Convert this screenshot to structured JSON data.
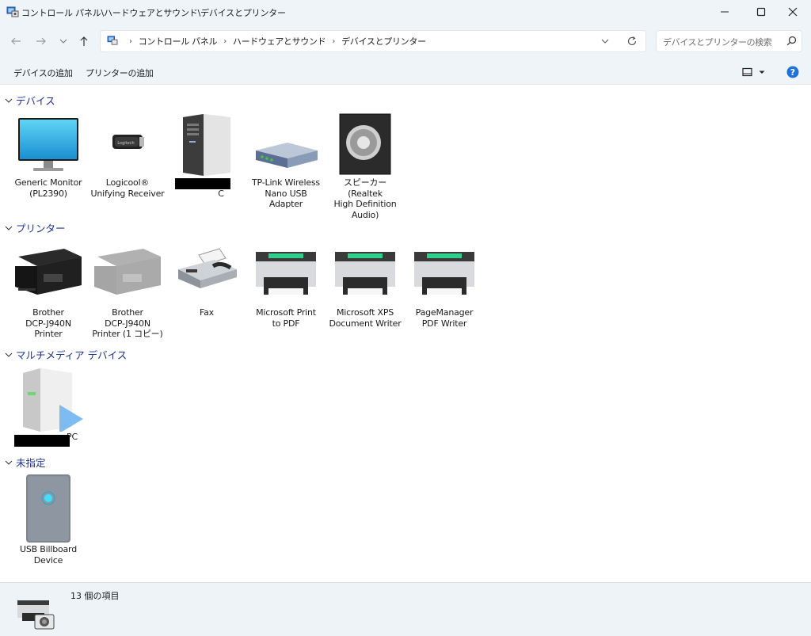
{
  "window": {
    "title": "コントロール パネル\\ハードウェアとサウンド\\デバイスとプリンター",
    "min_icon": "minimize-icon",
    "max_icon": "maximize-icon",
    "close_icon": "close-icon"
  },
  "nav": {
    "breadcrumbs": [
      "コントロール パネル",
      "ハードウェアとサウンド",
      "デバイスとプリンター"
    ],
    "search_placeholder": "デバイスとプリンターの検索"
  },
  "commands": {
    "add_device": "デバイスの追加",
    "add_printer": "プリンターの追加"
  },
  "groups": {
    "devices": {
      "header": "デバイス",
      "items": [
        {
          "label": "Generic Monitor\n(PL2390)",
          "icon": "monitor-icon"
        },
        {
          "label": "Logicool®\nUnifying Receiver",
          "icon": "usb-receiver-icon"
        },
        {
          "label": "-P\nC",
          "icon": "computer-tower-icon"
        },
        {
          "label": "TP-Link Wireless\nNano USB\nAdapter",
          "icon": "network-adapter-icon"
        },
        {
          "label": "スピーカー (Realtek\nHigh Definition\nAudio)",
          "icon": "speaker-icon"
        }
      ]
    },
    "printers": {
      "header": "プリンター",
      "items": [
        {
          "label": "Brother\nDCP-J940N\nPrinter",
          "icon": "multifunction-printer-icon"
        },
        {
          "label": "Brother\nDCP-J940N\nPrinter (1 コピー)",
          "icon": "multifunction-printer-disabled-icon"
        },
        {
          "label": "Fax",
          "icon": "fax-icon"
        },
        {
          "label": "Microsoft Print\nto PDF",
          "icon": "printer-icon"
        },
        {
          "label": "Microsoft XPS\nDocument Writer",
          "icon": "printer-icon"
        },
        {
          "label": "PageManager\nPDF Writer",
          "icon": "printer-icon"
        }
      ]
    },
    "multimedia": {
      "header": "マルチメディア デバイス",
      "items": [
        {
          "label": "PC",
          "icon": "media-server-icon"
        }
      ]
    },
    "unspecified": {
      "header": "未指定",
      "items": [
        {
          "label": "USB Billboard\nDevice",
          "icon": "generic-device-icon"
        }
      ]
    }
  },
  "status": {
    "count": "13 個の項目"
  }
}
